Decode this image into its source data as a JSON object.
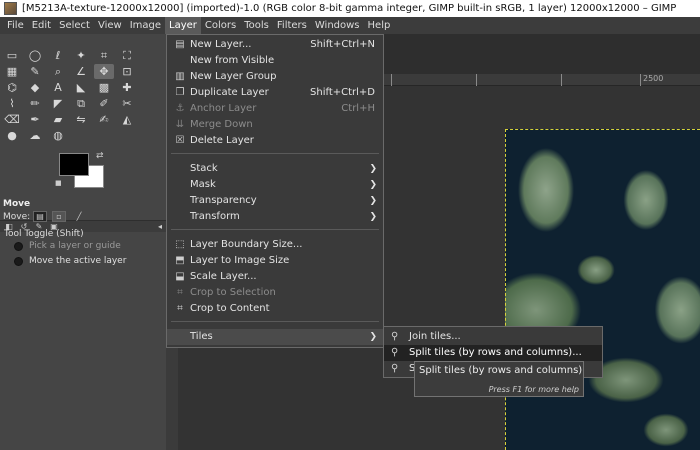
{
  "window": {
    "title": "[M5213A-texture-12000x12000] (imported)-1.0 (RGB color 8-bit gamma integer, GIMP built-in sRGB, 1 layer) 12000x12000 – GIMP"
  },
  "menubar": {
    "items": [
      "File",
      "Edit",
      "Select",
      "View",
      "Image",
      "Layer",
      "Colors",
      "Tools",
      "Filters",
      "Windows",
      "Help"
    ],
    "active": "Layer"
  },
  "layer_menu": {
    "new_layer": "New Layer...",
    "new_layer_shortcut": "Shift+Ctrl+N",
    "new_from_visible": "New from Visible",
    "new_layer_group": "New Layer Group",
    "duplicate_layer": "Duplicate Layer",
    "duplicate_layer_shortcut": "Shift+Ctrl+D",
    "anchor_layer": "Anchor Layer",
    "anchor_layer_shortcut": "Ctrl+H",
    "merge_down": "Merge Down",
    "delete_layer": "Delete Layer",
    "stack": "Stack",
    "mask": "Mask",
    "transparency": "Transparency",
    "transform": "Transform",
    "layer_boundary_size": "Layer Boundary Size...",
    "layer_to_image_size": "Layer to Image Size",
    "scale_layer": "Scale Layer...",
    "crop_to_selection": "Crop to Selection",
    "crop_to_content": "Crop to Content",
    "tiles": "Tiles"
  },
  "tiles_menu": {
    "join_tiles": "Join tiles...",
    "split_tiles": "Split tiles (by rows and columns)...",
    "third_item_partial": "S"
  },
  "tooltip": {
    "title": "Split tiles (by rows and columns)",
    "help": "Press F1 for more help"
  },
  "tool_options": {
    "title": "Move",
    "move_label": "Move:",
    "tool_toggle": "Tool Toggle  (Shift)",
    "option_pick": "Pick a layer or guide",
    "option_move_active": "Move the active layer"
  },
  "ruler": {
    "label_2500": "2500"
  },
  "colors": {
    "menubar_bg": "#3c3c3c",
    "menu_bg": "#3a3a3a",
    "canvas_bg": "#2e2e2e",
    "selection_outline": "#d8d23a"
  }
}
